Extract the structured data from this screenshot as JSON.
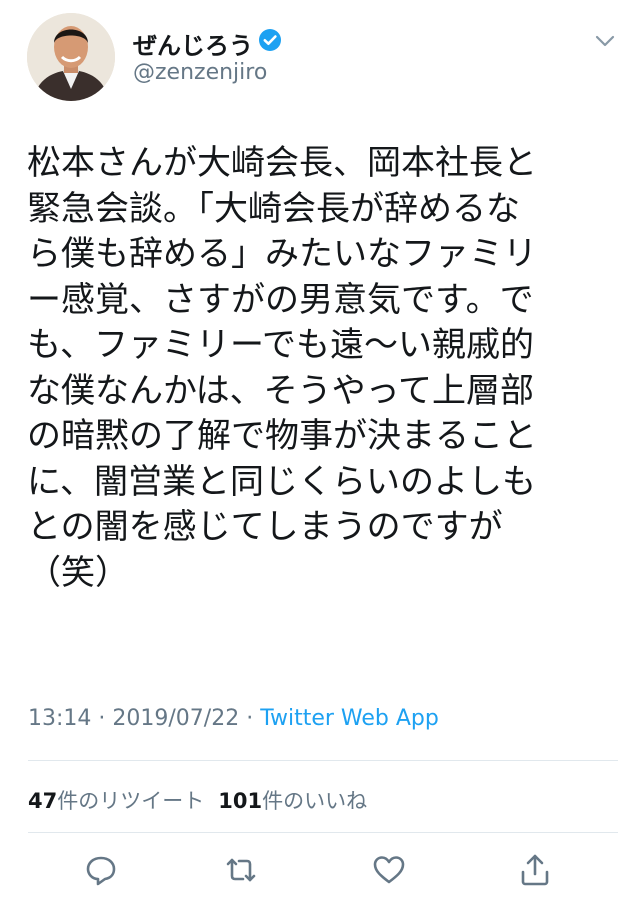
{
  "tweet": {
    "author": {
      "display_name": "ぜんじろう",
      "handle": "@zenzenjiro",
      "verified": true
    },
    "text_lines": [
      "松本さんが大崎会長、岡本社長と",
      "緊急会談。「大崎会長が辞めるな",
      "ら僕も辞める」みたいなファミリ",
      "ー感覚、さすがの男意気です。で",
      "も、ファミリーでも遠〜い親戚的",
      "な僕なんかは、そうやって上層部",
      "の暗黙の了解で物事が決まること",
      "に、闇営業と同じくらいのよしも",
      "との闇を感じてしまうのですが",
      "（笑）"
    ],
    "time": "13:14",
    "date": "2019/07/22",
    "separator": " · ",
    "source_app": "Twitter Web App",
    "stats": {
      "retweet_count": "47",
      "retweet_label": "件のリツイート",
      "like_count": "101",
      "like_label": "件のいいね"
    }
  },
  "actions": [
    "reply-icon",
    "retweet-icon",
    "like-icon",
    "share-icon"
  ],
  "colors": {
    "text": "#14171a",
    "secondary": "#657786",
    "link": "#1da1f2",
    "verified": "#1da1f2",
    "divider": "#e1e8ed"
  }
}
